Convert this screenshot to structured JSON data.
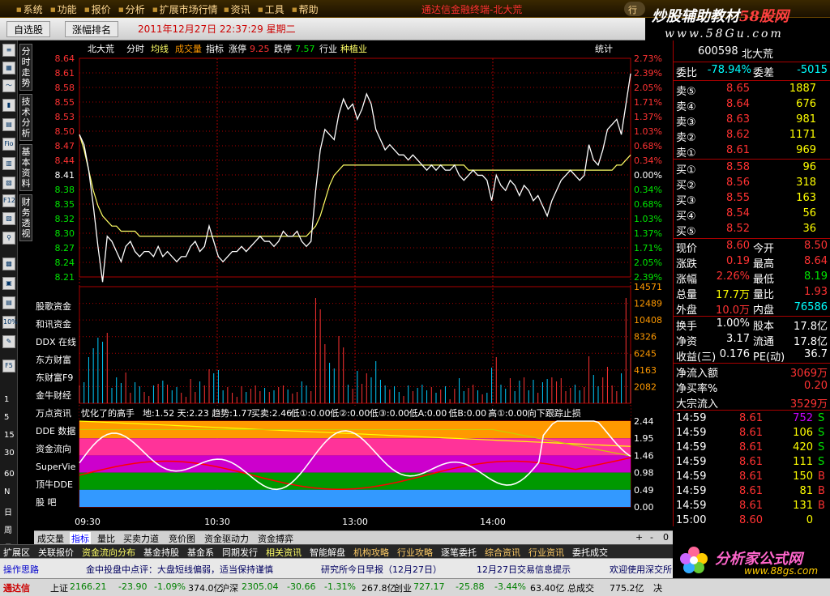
{
  "menubar": {
    "items": [
      "系统",
      "功能",
      "报价",
      "分析",
      "扩展市场行情",
      "资讯",
      "工具",
      "帮助"
    ],
    "app_title": "通达信金融终端-北大荒",
    "trade_button": "行",
    "brand_main_a": "炒股辅助教材",
    "brand_main_b": "58股网",
    "brand_sub": "www.58Gu.com"
  },
  "tabbar": {
    "tab1": "自选股",
    "tab2": "涨幅排名",
    "datetime": "2011年12月27日  22:37:29 星期二"
  },
  "left_numbers": [
    "1",
    "5",
    "15",
    "30",
    "60",
    "N",
    "日",
    "周",
    "月"
  ],
  "left_tools": [
    "Fio",
    "F12",
    "F5",
    "10%"
  ],
  "side_tabs": [
    "分时走势",
    "技术分析",
    "基本资料",
    "财务透视"
  ],
  "chart_header": {
    "name": "北大荒",
    "items": [
      "分时",
      "均线",
      "成交量",
      "指标"
    ],
    "rise_label": "涨停",
    "rise_value": "9.25",
    "fall_label": "跌停",
    "fall_value": "7.57",
    "industry_label": "行业",
    "industry_value": "种植业",
    "stats": "统计"
  },
  "indicator_header": {
    "name": "忧化了的高手",
    "items": [
      "地:1.52",
      "天:2.23",
      "趋势:1.77",
      "买卖:2.46",
      "低①:0.00",
      "低②:0.00",
      "低③:0.00",
      "低A:0.00",
      "低B:0.00",
      "高①:0.00",
      "向下跟踪止损"
    ]
  },
  "overlay_labels": [
    "股歌资金",
    "和讯资金",
    "DDX 在线",
    "东方财富",
    "东财富F9",
    "金牛财经",
    "万点资讯",
    "DDE 数据",
    "资金流向",
    "SuperVie",
    "顶牛DDE",
    "股  吧"
  ],
  "chart_colors": {
    "price_line": "#ffffff",
    "avg_line": "#ffff66",
    "up": "#ff3232",
    "down": "#00e600",
    "grid": "#aa0000",
    "band_orange": "#ff9900",
    "band_pink": "#ff3399",
    "band_purple": "#cc00cc",
    "band_green": "#009900",
    "band_blue": "#3399ff"
  },
  "bottom_tabs": [
    "成交量",
    "指标",
    "量比",
    "买卖力道",
    "竞价图",
    "资金驱动力",
    "资金搏弈"
  ],
  "bottom_ctrl": [
    "+",
    "-",
    "0"
  ],
  "module_tabs": [
    "扩展区",
    "关联报价",
    "资金流向分布",
    "基金持股",
    "基金系",
    "同期发行",
    "相关资讯",
    "智能解盘",
    "机构攻略",
    "行业攻略",
    "逐笔委托",
    "综合资讯",
    "行业资讯",
    "委托成交"
  ],
  "news": [
    "操作思路",
    "金中投盘中点评：大盘短线偏弱，适当保持谨慎",
    "研究所今日早报（12月27日）",
    "12月27日交易信息提示",
    "欢迎使用深交所"
  ],
  "statusbar": {
    "app": "通达信",
    "sh_label": "上证",
    "sh_price": "2166.21",
    "sh_chg": "-23.90",
    "sh_pct": "-1.09%",
    "sh_amt": "374.0亿",
    "sz_label": "沪深",
    "sz_price": "2305.04",
    "sz_chg": "-30.66",
    "sz_pct": "-1.31%",
    "sz_amt": "267.8亿",
    "cy_label": "创业",
    "cy_price": "727.17",
    "cy_chg": "-25.88",
    "cy_pct": "-3.44%",
    "cy_amt": "63.40亿",
    "total_label": "总成交",
    "total_value": "775.2亿",
    "end": "决"
  },
  "quote": {
    "code": "600598",
    "name": "北大荒",
    "weibi_label": "委比",
    "weibi_value": "-78.94%",
    "weicha_label": "委差",
    "weicha_value": "-5015",
    "sells": [
      {
        "label": "卖⑤",
        "price": "8.65",
        "vol": "1887"
      },
      {
        "label": "卖④",
        "price": "8.64",
        "vol": "676"
      },
      {
        "label": "卖③",
        "price": "8.63",
        "vol": "981"
      },
      {
        "label": "卖②",
        "price": "8.62",
        "vol": "1171"
      },
      {
        "label": "卖①",
        "price": "8.61",
        "vol": "969"
      }
    ],
    "buys": [
      {
        "label": "买①",
        "price": "8.58",
        "vol": "96"
      },
      {
        "label": "买②",
        "price": "8.56",
        "vol": "318"
      },
      {
        "label": "买③",
        "price": "8.55",
        "vol": "163"
      },
      {
        "label": "买④",
        "price": "8.54",
        "vol": "56"
      },
      {
        "label": "买⑤",
        "price": "8.52",
        "vol": "36"
      }
    ],
    "stats": [
      {
        "l1": "现价",
        "v1": "8.60",
        "c1": "red",
        "l2": "今开",
        "v2": "8.50",
        "c2": "red"
      },
      {
        "l1": "涨跌",
        "v1": "0.19",
        "c1": "red",
        "l2": "最高",
        "v2": "8.64",
        "c2": "red"
      },
      {
        "l1": "涨幅",
        "v1": "2.26%",
        "c1": "red",
        "l2": "最低",
        "v2": "8.19",
        "c2": "grn"
      },
      {
        "l1": "总量",
        "v1": "17.7万",
        "c1": "yel",
        "l2": "量比",
        "v2": "1.93",
        "c2": "red"
      },
      {
        "l1": "外盘",
        "v1": "10.0万",
        "c1": "red",
        "l2": "内盘",
        "v2": "76586",
        "c2": "cyan"
      }
    ],
    "stats2": [
      {
        "l1": "换手",
        "v1": "1.00%",
        "c1": "wht",
        "l2": "股本",
        "v2": "17.8亿",
        "c2": "wht"
      },
      {
        "l1": "净资",
        "v1": "3.17",
        "c1": "wht",
        "l2": "流通",
        "v2": "17.8亿",
        "c2": "wht"
      },
      {
        "l1": "收益(三)",
        "v1": "0.176",
        "c1": "wht",
        "l2": "PE(动)",
        "v2": "36.7",
        "c2": "wht"
      }
    ],
    "flow": [
      {
        "label": "净流入额",
        "value": "3069万"
      },
      {
        "label": "净买率%",
        "value": "0.20"
      },
      {
        "label": "大宗流入",
        "value": "3529万"
      }
    ],
    "ticks": [
      {
        "time": "14:59",
        "price": "8.61",
        "vol": "752",
        "side": "S",
        "vc": "#cc00ff"
      },
      {
        "time": "14:59",
        "price": "8.61",
        "vol": "106",
        "side": "S",
        "vc": "#ffff00"
      },
      {
        "time": "14:59",
        "price": "8.61",
        "vol": "420",
        "side": "S",
        "vc": "#ffff00"
      },
      {
        "time": "14:59",
        "price": "8.61",
        "vol": "111",
        "side": "S",
        "vc": "#ffff00"
      },
      {
        "time": "14:59",
        "price": "8.61",
        "vol": "150",
        "side": "B",
        "vc": "#ffff00"
      },
      {
        "time": "14:59",
        "price": "8.61",
        "vol": "81",
        "side": "B",
        "vc": "#ffff00"
      },
      {
        "time": "14:59",
        "price": "8.61",
        "vol": "131",
        "side": "B",
        "vc": "#ffff00"
      },
      {
        "time": "15:00",
        "price": "8.60",
        "vol": "0",
        "side": "",
        "vc": "#ffff00"
      }
    ]
  },
  "ad": {
    "main": "分析家公式网",
    "sub": "www.88gs.com"
  },
  "chart_data": {
    "type": "line",
    "price_axis": [
      "8.64",
      "8.61",
      "8.58",
      "8.55",
      "8.53",
      "8.50",
      "8.47",
      "8.44",
      "8.41",
      "8.38",
      "8.35",
      "8.32",
      "8.30",
      "8.27",
      "8.24",
      "8.21"
    ],
    "pct_axis": [
      "2.73%",
      "2.39%",
      "2.05%",
      "1.71%",
      "1.37%",
      "1.03%",
      "0.68%",
      "0.34%",
      "0.00%",
      "0.34%",
      "0.68%",
      "1.03%",
      "1.37%",
      "1.71%",
      "2.05%",
      "2.39%"
    ],
    "price_ylim": [
      8.21,
      8.64
    ],
    "volume_axis": [
      "14571",
      "12489",
      "10408",
      "8326",
      "6245",
      "4163",
      "2082"
    ],
    "volume_ylim": [
      0,
      14571
    ],
    "indicator_axis": [
      "2.44",
      "1.95",
      "1.46",
      "0.98",
      "0.49",
      "0.00"
    ],
    "indicator_ylim": [
      0,
      2.44
    ],
    "time_labels": [
      "09:30",
      "10:30",
      "13:00",
      "14:00"
    ],
    "price": [
      8.49,
      8.47,
      8.42,
      8.35,
      8.27,
      8.2,
      8.29,
      8.28,
      8.26,
      8.24,
      8.27,
      8.28,
      8.26,
      8.25,
      8.26,
      8.26,
      8.25,
      8.27,
      8.25,
      8.26,
      8.25,
      8.24,
      8.25,
      8.25,
      8.27,
      8.28,
      8.26,
      8.27,
      8.31,
      8.28,
      8.25,
      8.24,
      8.25,
      8.26,
      8.26,
      8.27,
      8.26,
      8.27,
      8.28,
      8.29,
      8.28,
      8.28,
      8.27,
      8.28,
      8.3,
      8.29,
      8.29,
      8.3,
      8.28,
      8.27,
      8.28,
      8.38,
      8.46,
      8.5,
      8.49,
      8.48,
      8.53,
      8.56,
      8.54,
      8.55,
      8.52,
      8.54,
      8.57,
      8.55,
      8.5,
      8.48,
      8.46,
      8.47,
      8.46,
      8.45,
      8.45,
      8.44,
      8.45,
      8.44,
      8.43,
      8.42,
      8.43,
      8.42,
      8.43,
      8.42,
      8.42,
      8.43,
      8.41,
      8.4,
      8.41,
      8.42,
      8.41,
      8.41,
      8.4,
      8.36,
      8.41,
      8.39,
      8.38,
      8.4,
      8.39,
      8.37,
      8.39,
      8.38,
      8.36,
      8.37,
      8.35,
      8.33,
      8.36,
      8.38,
      8.4,
      8.41,
      8.42,
      8.41,
      8.4,
      8.41,
      8.47,
      8.44,
      8.43,
      8.46,
      8.5,
      8.51,
      8.52,
      8.49,
      8.55,
      8.61
    ],
    "avg": [
      8.49,
      8.46,
      8.42,
      8.38,
      8.35,
      8.33,
      8.32,
      8.31,
      8.31,
      8.3,
      8.3,
      8.3,
      8.3,
      8.29,
      8.29,
      8.29,
      8.29,
      8.29,
      8.29,
      8.29,
      8.29,
      8.29,
      8.29,
      8.29,
      8.29,
      8.29,
      8.29,
      8.29,
      8.29,
      8.29,
      8.29,
      8.29,
      8.29,
      8.29,
      8.29,
      8.29,
      8.29,
      8.29,
      8.29,
      8.29,
      8.29,
      8.29,
      8.29,
      8.29,
      8.29,
      8.29,
      8.29,
      8.29,
      8.29,
      8.29,
      8.3,
      8.31,
      8.33,
      8.36,
      8.39,
      8.41,
      8.42,
      8.43,
      8.43,
      8.43,
      8.43,
      8.43,
      8.43,
      8.43,
      8.43,
      8.43,
      8.43,
      8.43,
      8.43,
      8.43,
      8.43,
      8.43,
      8.43,
      8.43,
      8.43,
      8.43,
      8.43,
      8.43,
      8.43,
      8.43,
      8.43,
      8.43,
      8.43,
      8.43,
      8.42,
      8.42,
      8.42,
      8.42,
      8.42,
      8.42,
      8.42,
      8.42,
      8.42,
      8.42,
      8.42,
      8.42,
      8.42,
      8.42,
      8.42,
      8.42,
      8.42,
      8.42,
      8.42,
      8.42,
      8.42,
      8.42,
      8.42,
      8.42,
      8.42,
      8.42,
      8.42,
      8.42,
      8.42,
      8.42,
      8.42,
      8.42,
      8.43,
      8.43,
      8.44,
      8.45
    ]
  }
}
